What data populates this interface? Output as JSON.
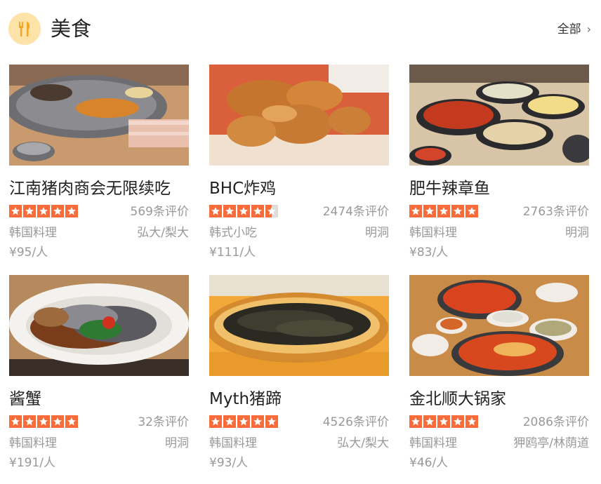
{
  "header": {
    "title": "美食",
    "all_label": "全部",
    "icon": "fork-knife-icon"
  },
  "colors": {
    "star": "#f86c3b",
    "icon_bg": "#fde3a7",
    "muted_text": "#999999"
  },
  "cards": [
    {
      "name": "江南猪肉商会无限续吃",
      "rating": 5,
      "reviews": "569条评价",
      "cuisine": "韩国料理",
      "area": "弘大/梨大",
      "price": "¥95/人"
    },
    {
      "name": "BHC炸鸡",
      "rating": 4.5,
      "reviews": "2474条评价",
      "cuisine": "韩式小吃",
      "area": "明洞",
      "price": "¥111/人"
    },
    {
      "name": "肥牛辣章鱼",
      "rating": 5,
      "reviews": "2763条评价",
      "cuisine": "韩国料理",
      "area": "明洞",
      "price": "¥83/人"
    },
    {
      "name": "酱蟹",
      "rating": 5,
      "reviews": "32条评价",
      "cuisine": "韩国料理",
      "area": "明洞",
      "price": "¥191/人"
    },
    {
      "name": "Myth猪蹄",
      "rating": 5,
      "reviews": "4526条评价",
      "cuisine": "韩国料理",
      "area": "弘大/梨大",
      "price": "¥93/人"
    },
    {
      "name": "金北顺大锅家",
      "rating": 5,
      "reviews": "2086条评价",
      "cuisine": "韩国料理",
      "area": "狎鸥亭/林荫道",
      "price": "¥46/人"
    }
  ]
}
